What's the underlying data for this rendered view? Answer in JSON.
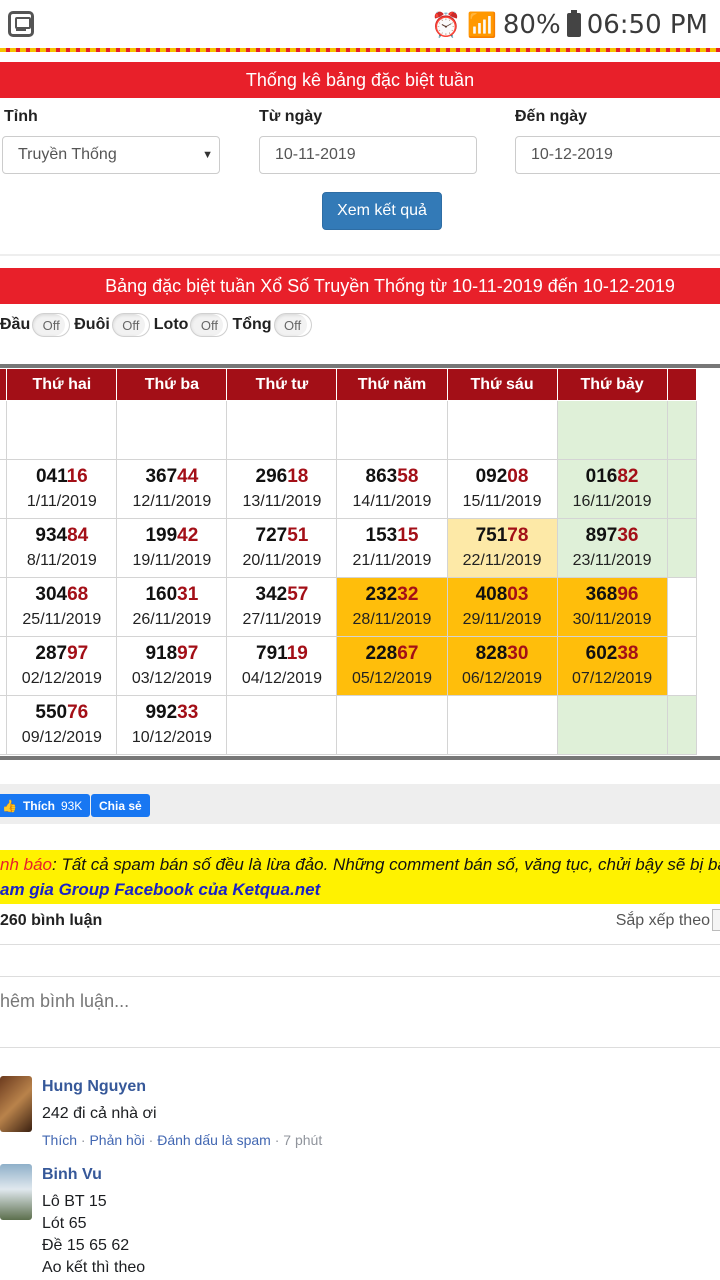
{
  "status_bar": {
    "battery": "80%",
    "time": "06:50 PM"
  },
  "title_bar": "Thống kê bảng đặc biệt tuần",
  "filters": {
    "province_label": "Tỉnh",
    "province_value": "Truyền Thống",
    "from_label": "Từ ngày",
    "from_value": "10-11-2019",
    "to_label": "Đến ngày",
    "to_value": "10-12-2019",
    "submit": "Xem kết quả"
  },
  "table_title": "Bảng đặc biệt tuần Xổ Số Truyền Thống từ 10-11-2019 đến 10-12-2019",
  "toggles": [
    {
      "label": "Đầu",
      "state": "Off"
    },
    {
      "label": "Đuôi",
      "state": "Off"
    },
    {
      "label": "Loto",
      "state": "Off"
    },
    {
      "label": "Tổng",
      "state": "Off"
    }
  ],
  "table": {
    "headers": [
      "",
      "Thứ hai",
      "Thứ ba",
      "Thứ tư",
      "Thứ năm",
      "Thứ sáu",
      "Thứ bảy",
      ""
    ],
    "rows": [
      [
        {
          "head": "",
          "tail": "",
          "date": "",
          "bg": "white"
        },
        {
          "head": "",
          "tail": "",
          "date": "",
          "bg": "white"
        },
        {
          "head": "",
          "tail": "",
          "date": "",
          "bg": "white"
        },
        {
          "head": "",
          "tail": "",
          "date": "",
          "bg": "white"
        },
        {
          "head": "",
          "tail": "",
          "date": "",
          "bg": "white"
        },
        {
          "head": "",
          "tail": "",
          "date": "",
          "bg": "white"
        },
        {
          "head": "",
          "tail": "",
          "date": "",
          "bg": "green"
        },
        {
          "head": "",
          "tail": "",
          "date": "",
          "bg": "green"
        }
      ],
      [
        {
          "head": "",
          "tail": "",
          "date": "",
          "bg": "white"
        },
        {
          "head": "041",
          "tail": "16",
          "date": "1/11/2019",
          "bg": "white"
        },
        {
          "head": "367",
          "tail": "44",
          "date": "12/11/2019",
          "bg": "white"
        },
        {
          "head": "296",
          "tail": "18",
          "date": "13/11/2019",
          "bg": "white"
        },
        {
          "head": "863",
          "tail": "58",
          "date": "14/11/2019",
          "bg": "white"
        },
        {
          "head": "092",
          "tail": "08",
          "date": "15/11/2019",
          "bg": "white"
        },
        {
          "head": "016",
          "tail": "82",
          "date": "16/11/2019",
          "bg": "green"
        },
        {
          "head": "",
          "tail": "",
          "date": "",
          "bg": "green"
        }
      ],
      [
        {
          "head": "",
          "tail": "",
          "date": "",
          "bg": "white"
        },
        {
          "head": "934",
          "tail": "84",
          "date": "8/11/2019",
          "bg": "white"
        },
        {
          "head": "199",
          "tail": "42",
          "date": "19/11/2019",
          "bg": "white"
        },
        {
          "head": "727",
          "tail": "51",
          "date": "20/11/2019",
          "bg": "white"
        },
        {
          "head": "153",
          "tail": "15",
          "date": "21/11/2019",
          "bg": "white"
        },
        {
          "head": "751",
          "tail": "78",
          "date": "22/11/2019",
          "bg": "light"
        },
        {
          "head": "897",
          "tail": "36",
          "date": "23/11/2019",
          "bg": "green"
        },
        {
          "head": "",
          "tail": "",
          "date": "",
          "bg": "green"
        }
      ],
      [
        {
          "head": "",
          "tail": "",
          "date": "",
          "bg": "white"
        },
        {
          "head": "304",
          "tail": "68",
          "date": "25/11/2019",
          "bg": "white"
        },
        {
          "head": "160",
          "tail": "31",
          "date": "26/11/2019",
          "bg": "white"
        },
        {
          "head": "342",
          "tail": "57",
          "date": "27/11/2019",
          "bg": "white"
        },
        {
          "head": "232",
          "tail": "32",
          "date": "28/11/2019",
          "bg": "gold"
        },
        {
          "head": "408",
          "tail": "03",
          "date": "29/11/2019",
          "bg": "gold"
        },
        {
          "head": "368",
          "tail": "96",
          "date": "30/11/2019",
          "bg": "gold"
        },
        {
          "head": "",
          "tail": "",
          "date": "",
          "bg": "white"
        }
      ],
      [
        {
          "head": "",
          "tail": "",
          "date": "",
          "bg": "white"
        },
        {
          "head": "287",
          "tail": "97",
          "date": "02/12/2019",
          "bg": "white"
        },
        {
          "head": "918",
          "tail": "97",
          "date": "03/12/2019",
          "bg": "white"
        },
        {
          "head": "791",
          "tail": "19",
          "date": "04/12/2019",
          "bg": "white"
        },
        {
          "head": "228",
          "tail": "67",
          "date": "05/12/2019",
          "bg": "gold"
        },
        {
          "head": "828",
          "tail": "30",
          "date": "06/12/2019",
          "bg": "gold"
        },
        {
          "head": "602",
          "tail": "38",
          "date": "07/12/2019",
          "bg": "gold"
        },
        {
          "head": "",
          "tail": "",
          "date": "",
          "bg": "white"
        }
      ],
      [
        {
          "head": "",
          "tail": "",
          "date": "",
          "bg": "white"
        },
        {
          "head": "550",
          "tail": "76",
          "date": "09/12/2019",
          "bg": "white"
        },
        {
          "head": "992",
          "tail": "33",
          "date": "10/12/2019",
          "bg": "white"
        },
        {
          "head": "",
          "tail": "",
          "date": "",
          "bg": "white"
        },
        {
          "head": "",
          "tail": "",
          "date": "",
          "bg": "white"
        },
        {
          "head": "",
          "tail": "",
          "date": "",
          "bg": "white"
        },
        {
          "head": "",
          "tail": "",
          "date": "",
          "bg": "green"
        },
        {
          "head": "",
          "tail": "",
          "date": "",
          "bg": "green"
        }
      ]
    ]
  },
  "social": {
    "like_label": "Thích",
    "like_count": "93K",
    "share_label": "Chia sẻ"
  },
  "warning": {
    "label": "nh báo",
    "text": ": Tất cả spam bán số đều là lừa đảo. Những comment bán số, văng tục, chửi bậy sẽ bị ban",
    "group_text": "am gia Group Facebook của Ketqua.net"
  },
  "comments_header": {
    "count": "260 bình luận",
    "sort": "Sắp xếp theo"
  },
  "comment_input_placeholder": "hêm bình luận...",
  "comments": [
    {
      "name": "Hung Nguyen",
      "lines": [
        "242 đi cả nhà ơi"
      ],
      "actions": {
        "like": "Thích",
        "reply": "Phản hồi",
        "spam": "Đánh dấu là spam",
        "time": "7 phút"
      }
    },
    {
      "name": "Binh Vu",
      "lines": [
        "Lô BT 15",
        "Lót 65",
        "Đề 15 65 62",
        "Ao kết thì theo"
      ]
    }
  ],
  "colors": {
    "red": "#e8202a",
    "dark_red": "#a30f17",
    "blue": "#337ab7",
    "gold": "#ffbe0b",
    "green": "#dff0d8"
  }
}
